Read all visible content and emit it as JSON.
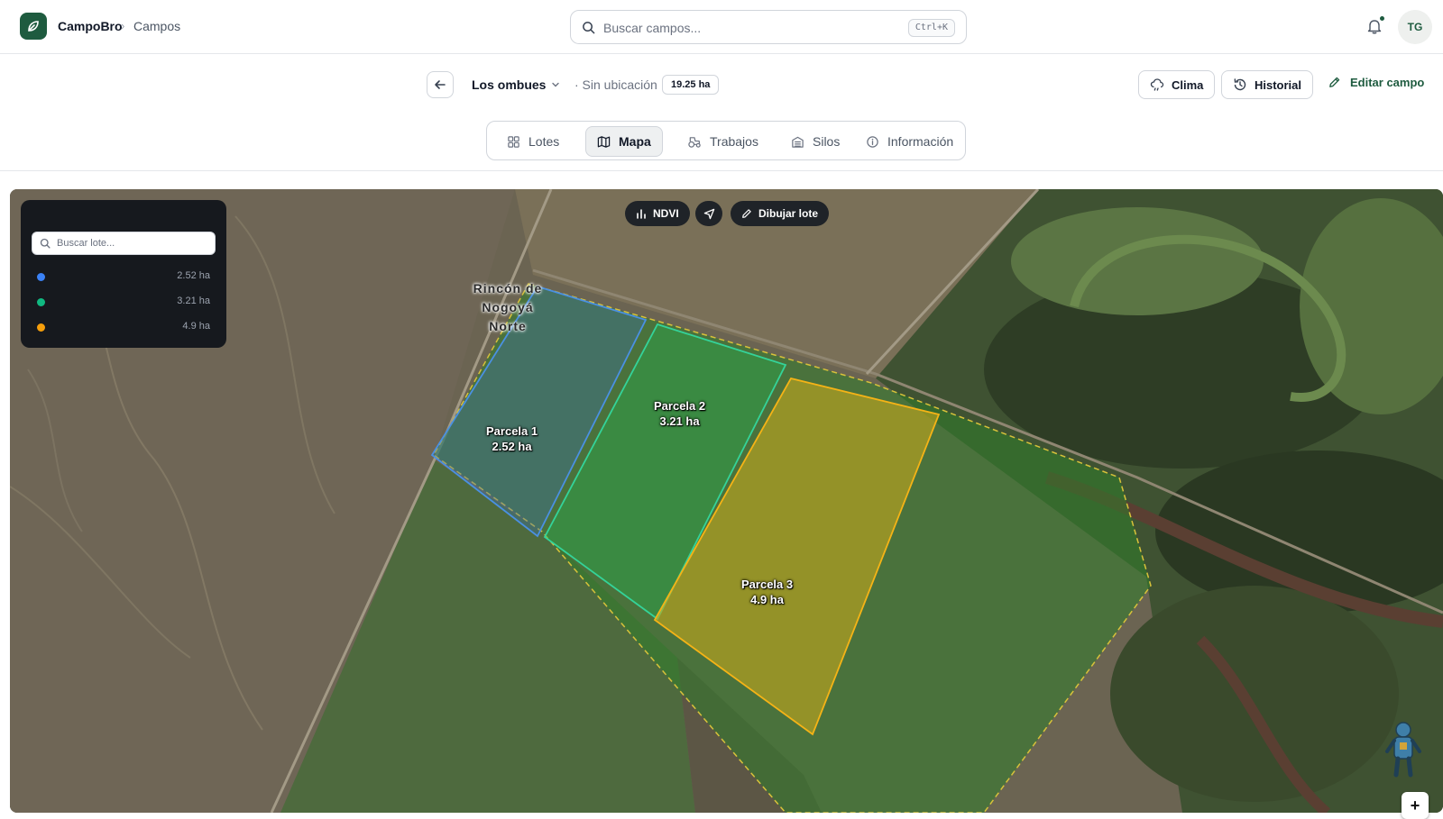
{
  "app": {
    "brand": "CampoBro",
    "breadcrumb_separator": "›",
    "breadcrumb": "Campos",
    "search_placeholder": "Buscar campos...",
    "search_shortcut": "Ctrl+K",
    "user_initials": "TG",
    "accent_color": "#1e5b3f",
    "icons": [
      "leaf-icon",
      "search-icon",
      "bell-icon"
    ]
  },
  "field": {
    "name": "Los ombues",
    "location": "· Sin ubicación",
    "area": "19.25 ha",
    "actions": {
      "weather": "Clima",
      "history": "Historial",
      "edit": "Editar campo"
    }
  },
  "tabs": [
    {
      "label": "Lotes",
      "icon": "grid-icon"
    },
    {
      "label": "Mapa",
      "icon": "map-icon",
      "active": true
    },
    {
      "label": "Trabajos",
      "icon": "tractor-icon"
    },
    {
      "label": "Silos",
      "icon": "silo-icon"
    },
    {
      "label": "Información",
      "icon": "info-icon"
    }
  ],
  "map": {
    "place_label": "Rincón de Nogoyá Norte",
    "toolbar": {
      "ndvi": "NDVI",
      "draw": "Dibujar lote"
    },
    "zoom_in": "+",
    "plots": [
      {
        "name": "Parcela 1",
        "area": "2.52 ha",
        "color": "#3b82f6"
      },
      {
        "name": "Parcela 2",
        "area": "3.21 ha",
        "color": "#22c55e"
      },
      {
        "name": "Parcela 3",
        "area": "4.9 ha",
        "color": "#eab308"
      }
    ]
  },
  "lot_panel": {
    "title": "",
    "search_placeholder": "Buscar lote...",
    "items": [
      {
        "name": "",
        "area": "2.52 ha",
        "color": "#3b82f6"
      },
      {
        "name": "",
        "area": "3.21 ha",
        "color": "#10b981"
      },
      {
        "name": "",
        "area": "4.9 ha",
        "color": "#f59e0b"
      }
    ]
  }
}
